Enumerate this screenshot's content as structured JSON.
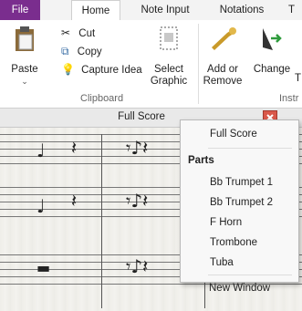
{
  "tabs": {
    "file": "File",
    "home": "Home",
    "note_input": "Note Input",
    "notations": "Notations",
    "next_partial": "T"
  },
  "clipboard": {
    "paste": "Paste",
    "cut": "Cut",
    "copy": "Copy",
    "capture_idea": "Capture Idea",
    "select_graphic_line1": "Select",
    "select_graphic_line2": "Graphic",
    "group_label": "Clipboard"
  },
  "instruments": {
    "add_remove_line1": "Add or",
    "add_remove_line2": "Remove",
    "change": "Change",
    "change_next": "T",
    "group_label": "Instr"
  },
  "score_window": {
    "title": "Full Score"
  },
  "menu": {
    "full_score": "Full Score",
    "parts_header": "Parts",
    "parts": [
      "Bb Trumpet 1",
      "Bb Trumpet 2",
      "F Horn",
      "Trombone",
      "Tuba"
    ],
    "new_window": "New Window"
  },
  "colors": {
    "file_tab": "#7a2d8e",
    "close_button": "#d9584a"
  }
}
